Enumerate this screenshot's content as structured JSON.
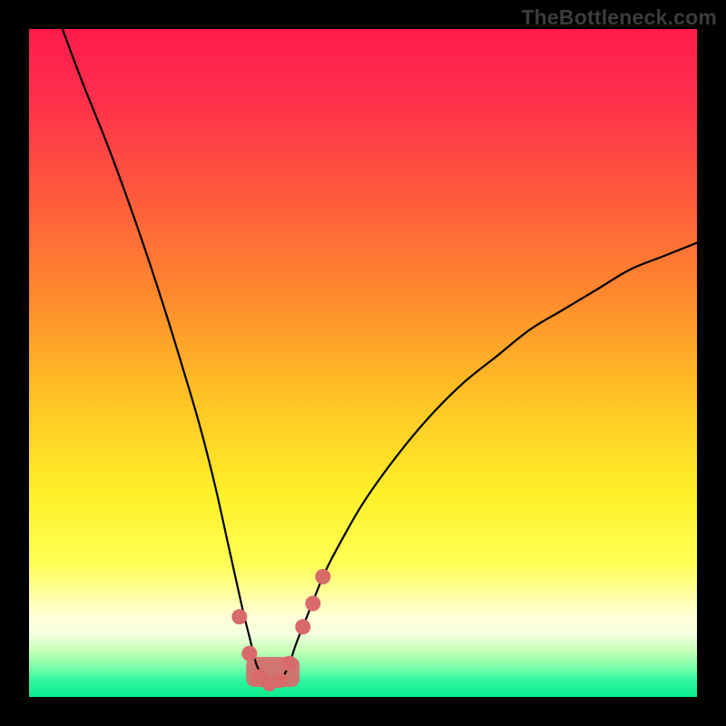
{
  "watermark": "TheBottleneck.com",
  "colors": {
    "frame": "#000000",
    "curve": "#000000",
    "marker": "#d86a6a",
    "gradient_stops": [
      {
        "pos": 0.0,
        "color": "#ff1b4c"
      },
      {
        "pos": 0.1,
        "color": "#ff2e4c"
      },
      {
        "pos": 0.25,
        "color": "#ff5a3c"
      },
      {
        "pos": 0.4,
        "color": "#ff8a2e"
      },
      {
        "pos": 0.55,
        "color": "#ffc224"
      },
      {
        "pos": 0.7,
        "color": "#fff12a"
      },
      {
        "pos": 0.8,
        "color": "#ffff55"
      },
      {
        "pos": 0.85,
        "color": "#ffffa8"
      },
      {
        "pos": 0.88,
        "color": "#ffffd8"
      },
      {
        "pos": 0.905,
        "color": "#f4ffe0"
      },
      {
        "pos": 0.93,
        "color": "#c9ffb8"
      },
      {
        "pos": 0.955,
        "color": "#7dffac"
      },
      {
        "pos": 0.975,
        "color": "#30f7a0"
      },
      {
        "pos": 1.0,
        "color": "#0aee8f"
      }
    ]
  },
  "chart_data": {
    "type": "line",
    "title": "",
    "xlabel": "",
    "ylabel": "",
    "xlim": [
      0,
      100
    ],
    "ylim": [
      0,
      100
    ],
    "series": [
      {
        "name": "bottleneck-curve",
        "x": [
          5,
          8,
          12,
          16,
          20,
          24,
          26,
          28,
          30,
          32,
          33,
          34,
          35,
          36,
          37,
          38,
          39,
          40,
          42,
          44,
          46,
          50,
          55,
          60,
          65,
          70,
          75,
          80,
          85,
          90,
          95,
          100
        ],
        "y": [
          100,
          92,
          82,
          71,
          59,
          46,
          39,
          31,
          22,
          13,
          9,
          5,
          3,
          2,
          2,
          3,
          5,
          8,
          13,
          18,
          22,
          29,
          36,
          42,
          47,
          51,
          55,
          58,
          61,
          64,
          66,
          68
        ]
      }
    ],
    "markers": {
      "name": "highlighted-points",
      "x": [
        31.5,
        33.0,
        34.5,
        36.0,
        37.5,
        39.0,
        41.0,
        42.5,
        44.0
      ],
      "y": [
        12.0,
        6.5,
        3.0,
        2.0,
        2.5,
        5.0,
        10.5,
        14.0,
        18.0
      ]
    },
    "valley_band": {
      "x_start": 32.5,
      "x_end": 40.5,
      "y_top": 6.0,
      "y_bottom": 1.5
    }
  }
}
